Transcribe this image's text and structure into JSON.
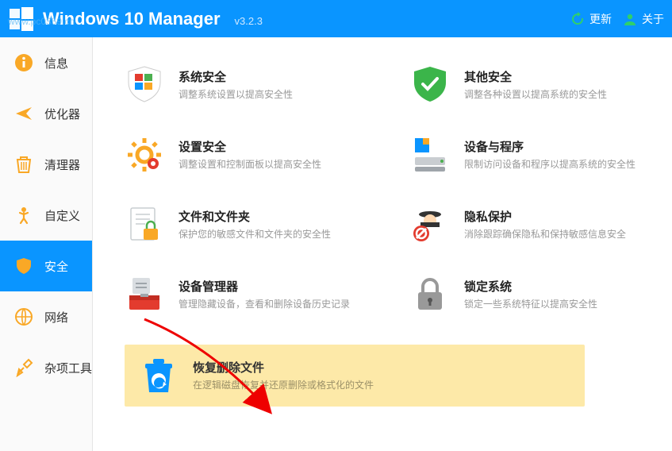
{
  "header": {
    "title": "Windows 10 Manager",
    "version": "v3.2.3",
    "update_label": "更新",
    "about_label": "关于"
  },
  "watermark": "www.pc0359.cn",
  "sidebar": {
    "items": [
      {
        "label": "信息"
      },
      {
        "label": "优化器"
      },
      {
        "label": "清理器"
      },
      {
        "label": "自定义"
      },
      {
        "label": "安全"
      },
      {
        "label": "网络"
      },
      {
        "label": "杂项工具"
      }
    ]
  },
  "cards": {
    "system_security": {
      "title": "系统安全",
      "desc": "调整系统设置以提高安全性"
    },
    "other_security": {
      "title": "其他安全",
      "desc": "调整各种设置以提高系统的安全性"
    },
    "settings_security": {
      "title": "设置安全",
      "desc": "调整设置和控制面板以提高安全性"
    },
    "device_program": {
      "title": "设备与程序",
      "desc": "限制访问设备和程序以提高系统的安全性"
    },
    "file_folder": {
      "title": "文件和文件夹",
      "desc": "保护您的敏感文件和文件夹的安全性"
    },
    "privacy": {
      "title": "隐私保护",
      "desc": "消除跟踪确保隐私和保持敏感信息安全"
    },
    "device_manager": {
      "title": "设备管理器",
      "desc": "管理隐藏设备，查看和删除设备历史记录"
    },
    "lock_system": {
      "title": "锁定系统",
      "desc": "锁定一些系统特征以提高安全性"
    },
    "recover_deleted": {
      "title": "恢复删除文件",
      "desc": "在逻辑磁盘恢复并还原删除或格式化的文件"
    }
  }
}
